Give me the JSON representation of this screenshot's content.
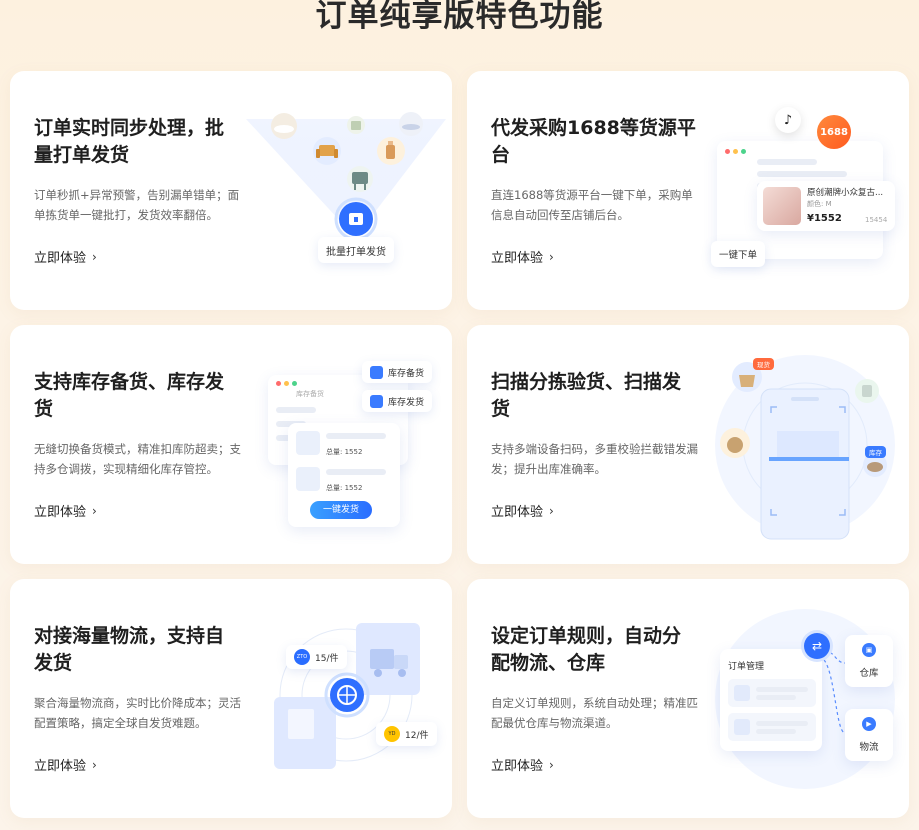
{
  "page": {
    "title": "订单纯享版特色功能"
  },
  "cards": [
    {
      "title": "订单实时同步处理，批量打单发货",
      "desc": "订单秒抓+异常预警，告别漏单错单；面单拣货单一键批打，发货效率翻倍。",
      "link": "立即体验",
      "illus": {
        "button": "批量打单发货"
      }
    },
    {
      "title": "代发采购1688等货源平台",
      "desc": "直连1688等货源平台一键下单，采购单信息自动回传至店铺后台。",
      "link": "立即体验",
      "illus": {
        "badge": "1688",
        "product_name": "原创潮牌小众复古...",
        "product_sub": "颜色: M",
        "price": "¥1552",
        "sales": "15454",
        "button": "一键下单"
      }
    },
    {
      "title": "支持库存备货、库存发货",
      "desc": "无缝切换备货模式，精准扣库防超卖；支持多仓调拨，实现精细化库存管控。",
      "link": "立即体验",
      "illus": {
        "tag1": "库存备货",
        "tag2": "库存发货",
        "panel_title": "库存备货",
        "qty1": "总量: 1552",
        "qty2": "总量: 1552",
        "button": "一键发货"
      }
    },
    {
      "title": "扫描分拣验货、扫描发货",
      "desc": "支持多端设备扫码，多重校验拦截错发漏发；提升出库准确率。",
      "link": "立即体验",
      "illus": {
        "badge1": "现货",
        "badge2": "库存"
      }
    },
    {
      "title": "对接海量物流，支持自发货",
      "desc": "聚合海量物流商，实时比价降成本；灵活配置策略，搞定全球自发货难题。",
      "link": "立即体验",
      "illus": {
        "logo1": "ZTO",
        "price1": "15/件",
        "logo2": "YD",
        "price2": "12/件"
      }
    },
    {
      "title": "设定订单规则，自动分配物流、仓库",
      "desc": "自定义订单规则，系统自动处理；精准匹配最优仓库与物流渠道。",
      "link": "立即体验",
      "illus": {
        "panel_title": "订单管理",
        "target1": "仓库",
        "target2": "物流"
      }
    }
  ],
  "colors": {
    "accent": "#2a6dff",
    "orange": "#ff7a2a",
    "bg": "#fdf1df"
  }
}
